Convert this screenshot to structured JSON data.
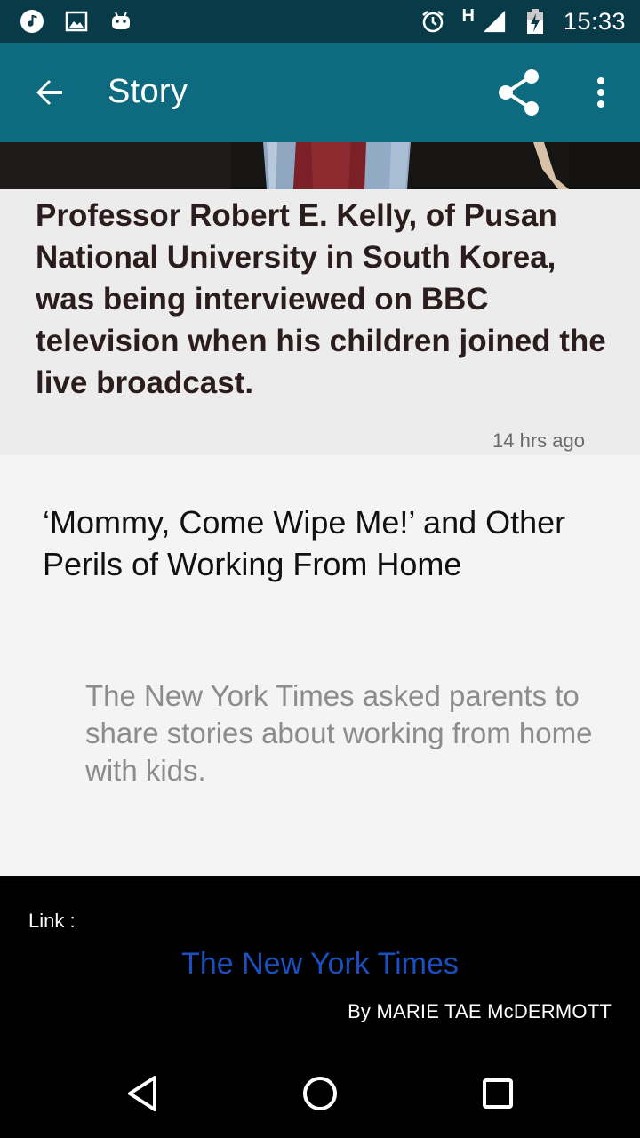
{
  "status_bar": {
    "time": "15:33",
    "network": "H",
    "left_icons": [
      "music-note-icon",
      "image-icon",
      "android-icon"
    ],
    "right_icons": [
      "alarm-icon",
      "signal-icon",
      "battery-charging-icon"
    ]
  },
  "app_bar": {
    "title": "Story",
    "back_icon": "arrow-back-icon",
    "share_icon": "share-icon",
    "more_icon": "more-vert-icon"
  },
  "story": {
    "caption": "Professor Robert E. Kelly, of Pusan National University in South Korea, was being interviewed on BBC television when his children joined the live broadcast.",
    "timestamp": "14 hrs ago",
    "title": "‘Mommy, Come Wipe Me!’ and Other Perils of Working From Home",
    "summary": "The New York Times asked parents to share stories about working from home with kids."
  },
  "footer": {
    "link_label": "Link :",
    "source_name": "The New York Times",
    "byline": "By MARIE TAE McDERMOTT"
  },
  "nav_bar": {
    "icons": [
      "nav-back-icon",
      "nav-home-icon",
      "nav-recents-icon"
    ]
  },
  "colors": {
    "status_bar": "#093a48",
    "app_bar": "#0e6a7e",
    "caption_bg": "#ececec",
    "story_bg": "#f4f4f4",
    "footer_bg": "#000000",
    "link": "#1a4fc2"
  }
}
